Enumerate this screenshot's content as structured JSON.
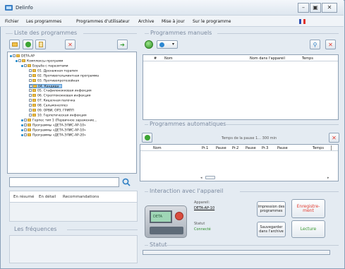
{
  "window": {
    "title": "Delinfo",
    "controls": [
      "–",
      "▣",
      "✕"
    ]
  },
  "menu": {
    "items": [
      "Fichier",
      "Les programmes",
      "Programmes d'utilisateur",
      "Archive",
      "Mise à jour",
      "Sur le programme"
    ]
  },
  "program_list": {
    "title": "Liste des programmes",
    "tree": [
      {
        "label": "DETA-AP",
        "level": 0
      },
      {
        "label": "Комплексы программ",
        "level": 1
      },
      {
        "label": "Борьба с паразитами",
        "level": 2
      },
      {
        "label": "01. Дренажная терапия",
        "level": 3
      },
      {
        "label": "02. Противогельминтная программа",
        "level": 3
      },
      {
        "label": "03. Противопротозойная",
        "level": 3
      },
      {
        "label": "04. Кандида",
        "level": 3,
        "selected": true
      },
      {
        "label": "05. Стафилококковая инфекция",
        "level": 3
      },
      {
        "label": "06. Стрептококковая инфекция",
        "level": 3
      },
      {
        "label": "07. Кишечная палочка",
        "level": 3
      },
      {
        "label": "08. Сальмонеллез",
        "level": 3
      },
      {
        "label": "09. ОРВИ, ОРЗ, ГРИПП",
        "level": 3
      },
      {
        "label": "10. Герпетическая инфекция",
        "level": 3
      },
      {
        "label": "Герпес тип 1 (Первичное заражение...",
        "level": 2
      },
      {
        "label": "Программы «ДЕТА-ЭЛИС-АР-10»",
        "level": 2
      },
      {
        "label": "Программы «ДЕТА-ЭЛИС-АР-10»",
        "level": 2
      },
      {
        "label": "Программы «ДЕТА-ЭЛИС-АР-20»",
        "level": 2
      }
    ],
    "search_value": "",
    "tabs": [
      "En résumé",
      "En détail",
      "Recommandations"
    ]
  },
  "frequencies": {
    "title": "Les fréquences"
  },
  "manual_programs": {
    "title": "Programmes manuels",
    "columns": [
      "#",
      "Nom",
      "Nom dans l'appareil",
      "Temps"
    ]
  },
  "auto_programs": {
    "title": "Programmes automatiques",
    "pause_label": "Temps de la pause 1... 300 min",
    "columns": [
      "Nom",
      "Pr.1",
      "Pause",
      "Pr.2",
      "Pause",
      "Pr.3",
      "Pause",
      "Temps"
    ]
  },
  "device": {
    "title": "Interaction avec l'appareil",
    "device_label": "Appareil:",
    "device_value": "DETA-AP-10",
    "status_label": "Statut",
    "status_value": "Connecté",
    "btn_print": "Impression des programmes",
    "btn_record": "Enregistre-ment",
    "btn_save": "Sauvegarder dans l'archive",
    "btn_read": "Lecture",
    "screen_text": "DETA"
  },
  "status": {
    "title": "Statut"
  },
  "colors": {
    "accent_red": "#e23b2e",
    "accent_green": "#3a9a2f",
    "title_gray": "#7b8aa0",
    "selection": "#9fc9ee"
  }
}
